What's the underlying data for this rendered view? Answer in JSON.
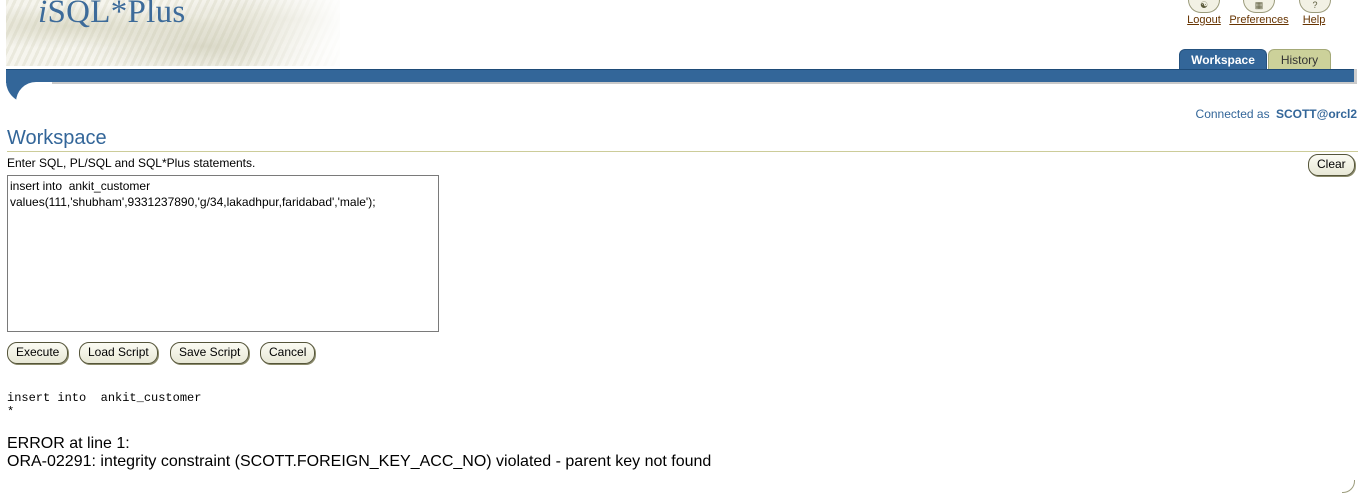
{
  "app": {
    "logo_text": "iSQL*Plus"
  },
  "global_links": {
    "logout": "Logout",
    "preferences": "Preferences",
    "help": "Help",
    "help_icon_glyph": "?"
  },
  "tabs": [
    {
      "label": "Workspace",
      "active": true
    },
    {
      "label": "History",
      "active": false
    }
  ],
  "connection": {
    "prefix": "Connected as",
    "user": "SCOTT@orcl2"
  },
  "workspace": {
    "title": "Workspace",
    "instructions": "Enter SQL, PL/SQL and SQL*Plus statements.",
    "clear_label": "Clear",
    "sql_text": "insert into  ankit_customer\nvalues(111,'shubham',9331237890,'g/34,lakadhpur,faridabad','male');",
    "buttons": {
      "execute": "Execute",
      "load_script": "Load Script",
      "save_script": "Save Script",
      "cancel": "Cancel"
    }
  },
  "output": {
    "echo_line": "insert into  ankit_customer",
    "marker": "*",
    "error_heading": "ERROR at line 1:",
    "error_message": "ORA-02291: integrity constraint (SCOTT.FOREIGN_KEY_ACC_NO) violated - parent key not found"
  },
  "colors": {
    "accent": "#336699",
    "inactive_tab": "#ccd19a",
    "link": "#663300"
  }
}
